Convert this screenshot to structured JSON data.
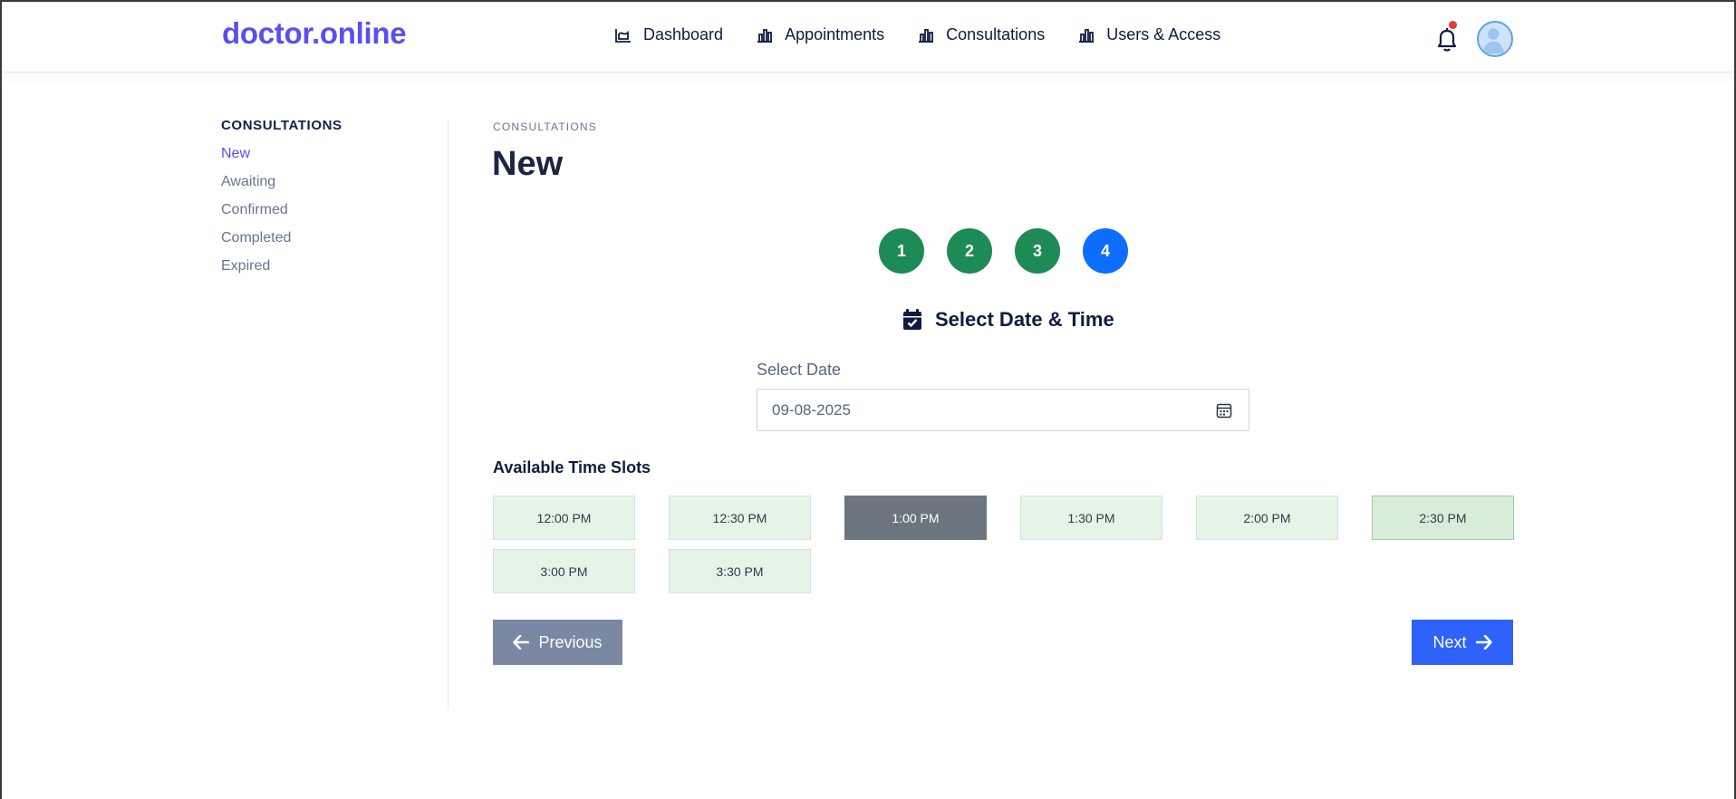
{
  "header": {
    "brand": "doctor.online",
    "nav": [
      {
        "label": "Dashboard",
        "icon": "chart-area-icon"
      },
      {
        "label": "Appointments",
        "icon": "bar-chart-icon"
      },
      {
        "label": "Consultations",
        "icon": "bar-chart-icon"
      },
      {
        "label": "Users & Access",
        "icon": "bar-chart-icon"
      }
    ],
    "notification_icon": "bell-icon",
    "has_notification": true,
    "avatar_icon": "user-avatar-icon"
  },
  "sidebar": {
    "title": "CONSULTATIONS",
    "items": [
      {
        "label": "New",
        "active": true
      },
      {
        "label": "Awaiting",
        "active": false
      },
      {
        "label": "Confirmed",
        "active": false
      },
      {
        "label": "Completed",
        "active": false
      },
      {
        "label": "Expired",
        "active": false
      }
    ]
  },
  "main": {
    "breadcrumb": "CONSULTATIONS",
    "title": "New",
    "steps": [
      {
        "label": "1",
        "state": "completed",
        "color": "#1e8a55"
      },
      {
        "label": "2",
        "state": "completed",
        "color": "#1e8a55"
      },
      {
        "label": "3",
        "state": "completed",
        "color": "#1e8a55"
      },
      {
        "label": "4",
        "state": "current",
        "color": "#0d6efd"
      }
    ],
    "section_heading": "Select Date & Time",
    "section_icon": "calendar-check-icon",
    "date_label": "Select Date",
    "date_value": "09-08-2025",
    "date_icon": "calendar-icon",
    "slots_title": "Available Time Slots",
    "slots": [
      {
        "label": "12:00 PM",
        "state": "available"
      },
      {
        "label": "12:30 PM",
        "state": "available"
      },
      {
        "label": "1:00 PM",
        "state": "selected"
      },
      {
        "label": "1:30 PM",
        "state": "available"
      },
      {
        "label": "2:00 PM",
        "state": "available"
      },
      {
        "label": "2:30 PM",
        "state": "hover"
      },
      {
        "label": "3:00 PM",
        "state": "available"
      },
      {
        "label": "3:30 PM",
        "state": "available"
      }
    ],
    "prev_label": "Previous",
    "prev_icon": "arrow-left-icon",
    "next_label": "Next",
    "next_icon": "arrow-right-icon"
  },
  "colors": {
    "brand": "#5b4ef0",
    "step_done": "#1e8a55",
    "step_current": "#0d6efd",
    "slot_selected": "#6c757d",
    "btn_prev": "#7b88a3",
    "btn_next": "#2f62fb"
  }
}
